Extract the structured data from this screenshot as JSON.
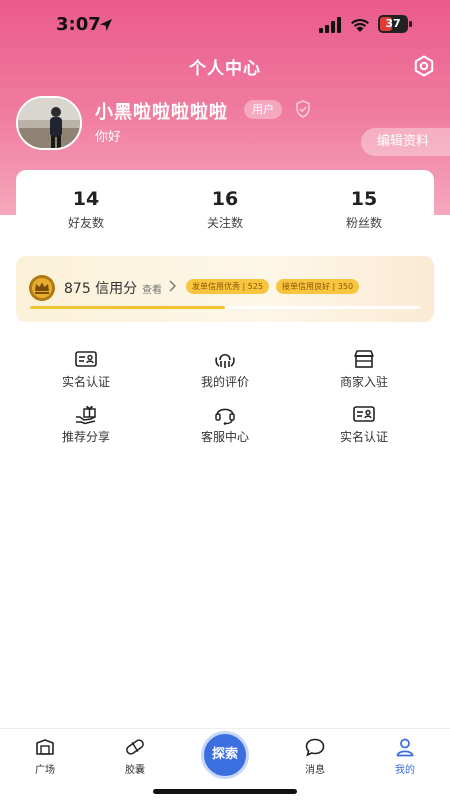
{
  "status_bar": {
    "time": "3:07",
    "battery": "37"
  },
  "header": {
    "title": "个人中心"
  },
  "profile": {
    "username": "小黑啦啦啦啦啦",
    "badge": "用户",
    "signature": "你好",
    "edit_label": "编辑资料"
  },
  "stats": [
    {
      "value": "14",
      "label": "好友数"
    },
    {
      "value": "16",
      "label": "关注数"
    },
    {
      "value": "15",
      "label": "粉丝数"
    }
  ],
  "credit": {
    "score_text": "875 信用分",
    "view_label": "查看",
    "tags": [
      "发单信用优秀 | 525",
      "接单信用良好 | 350"
    ],
    "progress_fraction": 0.5,
    "colors": {
      "fill": "#f2c230",
      "tag": "#f7c53f"
    }
  },
  "menu": [
    {
      "label": "实名认证",
      "icon": "id-card-icon"
    },
    {
      "label": "我的评价",
      "icon": "comment-icon"
    },
    {
      "label": "商家入驻",
      "icon": "store-icon"
    },
    {
      "label": "推荐分享",
      "icon": "gift-share-icon"
    },
    {
      "label": "客服中心",
      "icon": "headset-icon"
    },
    {
      "label": "实名认证",
      "icon": "id-card-icon"
    }
  ],
  "tabbar": {
    "items": [
      {
        "label": "广场",
        "icon": "plaza-icon"
      },
      {
        "label": "胶囊",
        "icon": "capsule-icon"
      },
      {
        "label": "消息",
        "icon": "message-icon"
      },
      {
        "label": "我的",
        "icon": "profile-icon",
        "active": true
      }
    ],
    "center_label": "探索",
    "active_color": "#3b6fe0"
  },
  "colors": {
    "header_top": "#ea5a8c",
    "header_bottom": "#f6a8bd",
    "accent": "#3b6fe0"
  }
}
